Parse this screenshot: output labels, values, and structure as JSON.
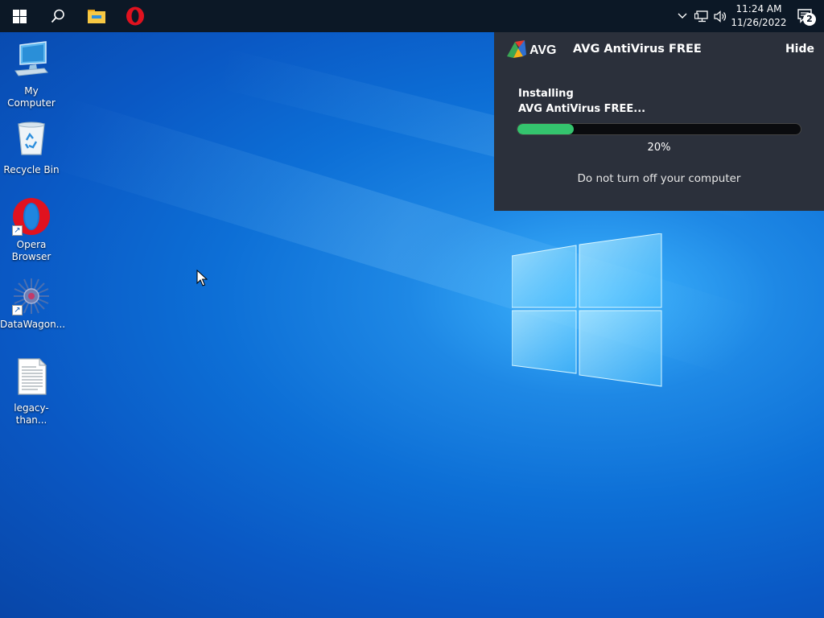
{
  "desktop": {
    "icons": [
      {
        "label": "My Computer"
      },
      {
        "label": "Recycle Bin"
      },
      {
        "label": "Opera\nBrowser"
      },
      {
        "label": "DataWagon..."
      },
      {
        "label": "legacy-than..."
      }
    ]
  },
  "taskbar": {
    "pinned": [
      "windows-start-icon",
      "search-icon",
      "file-explorer-icon",
      "opera-icon"
    ],
    "clock": {
      "time": "11:24 AM",
      "date": "11/26/2022"
    },
    "notifications_count": "2"
  },
  "avg_window": {
    "title": "AVG AntiVirus FREE",
    "logo_text": "AVG",
    "hide_label": "Hide",
    "status_line1": "Installing",
    "status_line2": "AVG AntiVirus FREE...",
    "progress_fraction": 0.2,
    "progress_label": "20%",
    "note": "Do not turn off your computer",
    "colors": {
      "background": "#2b303b",
      "progress": "#34c46e"
    }
  }
}
